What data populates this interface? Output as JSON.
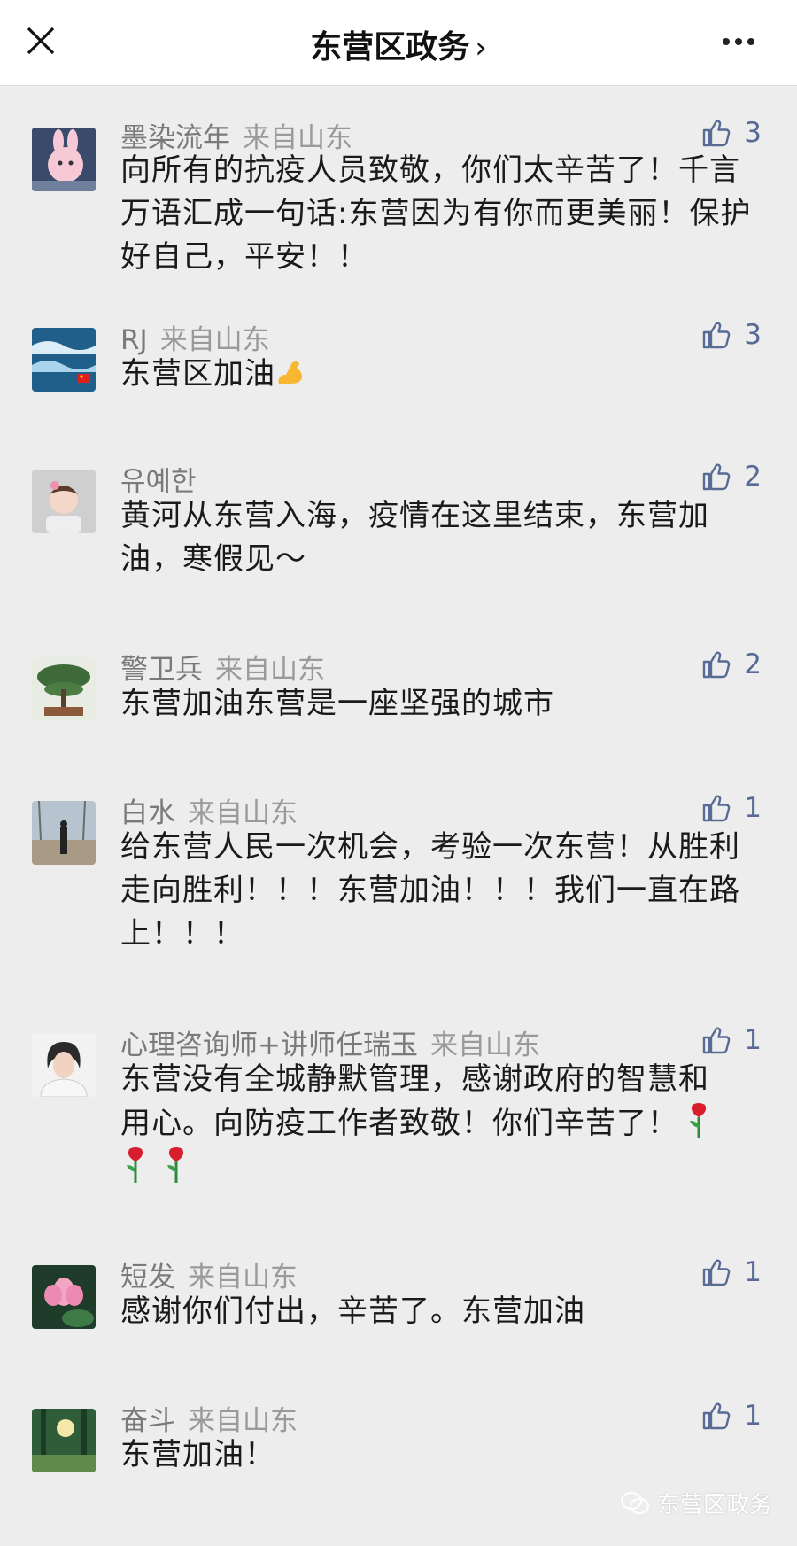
{
  "header": {
    "title": "东营区政务",
    "chevron": "›",
    "close_icon": "close-icon",
    "more_icon": "more-icon"
  },
  "comments": [
    {
      "name": "墨染流年",
      "source": "来自山东",
      "likes": "3",
      "text": "向所有的抗疫人员致敬，你们太辛苦了！千言万语汇成一句话:东营因为有你而更美丽！保护好自己，平安！！"
    },
    {
      "name": "RJ",
      "source": "来自山东",
      "likes": "3",
      "text": "东营区加油",
      "emoji": "flexed-biceps"
    },
    {
      "name": "유예한",
      "source": "",
      "likes": "2",
      "text": "黄河从东营入海，疫情在这里结束，东营加油，寒假见～"
    },
    {
      "name": "警卫兵",
      "source": "来自山东",
      "likes": "2",
      "text": "东营加油东营是一座坚强的城市"
    },
    {
      "name": "白水",
      "source": "来自山东",
      "likes": "1",
      "text": "给东营人民一次机会，考验一次东营！从胜利走向胜利！！！东营加油！！！我们一直在路上！！！"
    },
    {
      "name": "心理咨询师+讲师任瑞玉",
      "source": "来自山东",
      "likes": "1",
      "text_line1": "东营没有全城静默管理，感谢政府的智慧和",
      "text_line2": "用心。向防疫工作者致敬！你们辛苦了！",
      "emoji": "rose"
    },
    {
      "name": "短发",
      "source": "来自山东",
      "likes": "1",
      "text": "感谢你们付出，辛苦了。东营加油"
    },
    {
      "name": "奋斗",
      "source": "来自山东",
      "likes": "1",
      "text": "东营加油！"
    }
  ],
  "watermark": "东营区政务",
  "colors": {
    "background": "#ededed",
    "like": "#576b95",
    "meta": "#7a7a7a"
  }
}
